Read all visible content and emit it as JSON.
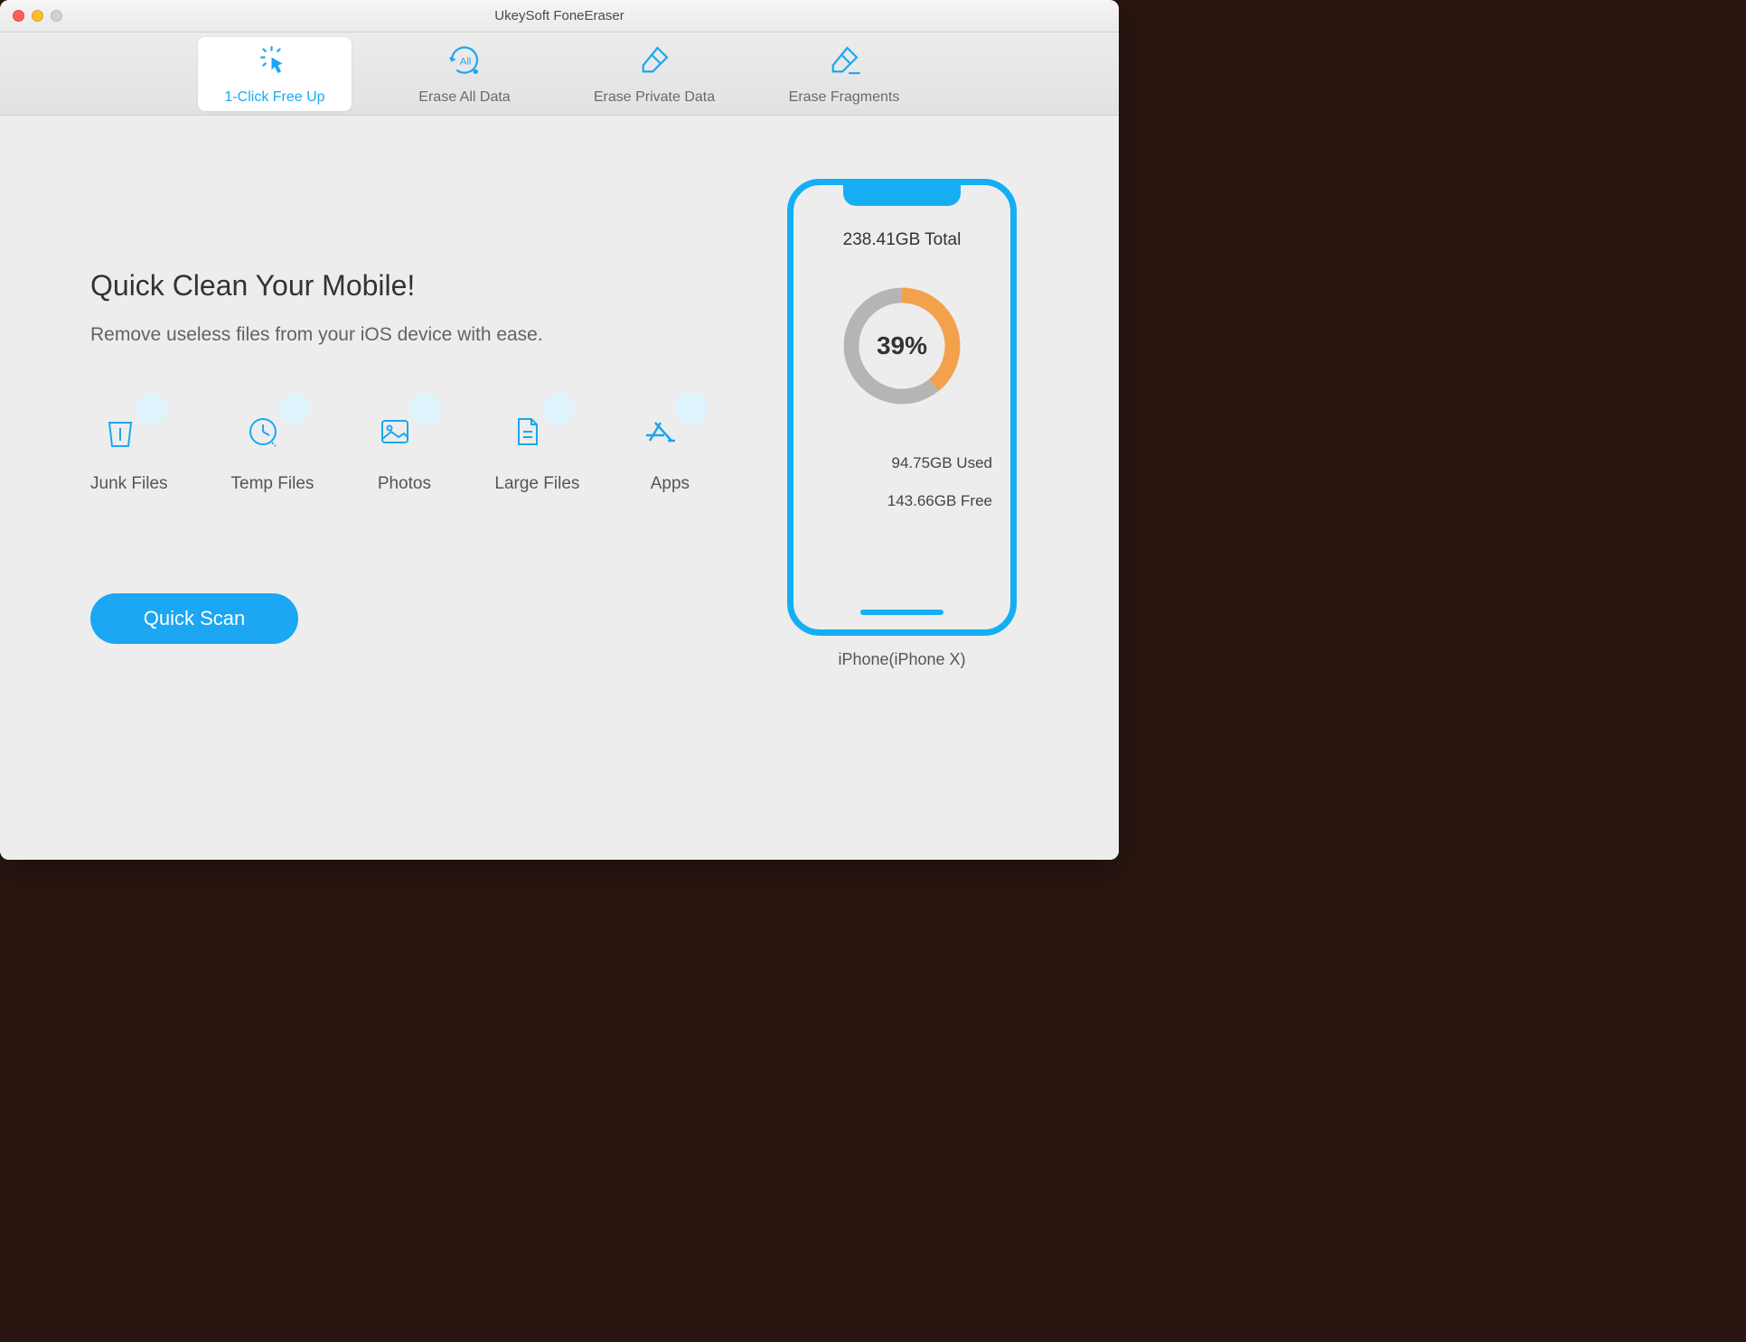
{
  "window": {
    "title": "UkeySoft FoneEraser"
  },
  "tabs": {
    "free_up": "1-Click Free Up",
    "erase_all": "Erase All Data",
    "erase_private": "Erase Private Data",
    "erase_fragments": "Erase Fragments"
  },
  "main": {
    "headline": "Quick Clean Your Mobile!",
    "subline": "Remove useless files from your iOS device with ease.",
    "categories": {
      "junk": "Junk Files",
      "temp": "Temp Files",
      "photos": "Photos",
      "large": "Large Files",
      "apps": "Apps"
    },
    "scan_button": "Quick Scan"
  },
  "device": {
    "total": "238.41GB Total",
    "percent": "39%",
    "percent_value": 39,
    "used": "94.75GB Used",
    "free": "143.66GB Free",
    "name": "iPhone(iPhone X)"
  },
  "colors": {
    "accent": "#1ba7f1",
    "donut_used": "#f3a14b",
    "donut_bg": "#b5b5b5"
  }
}
